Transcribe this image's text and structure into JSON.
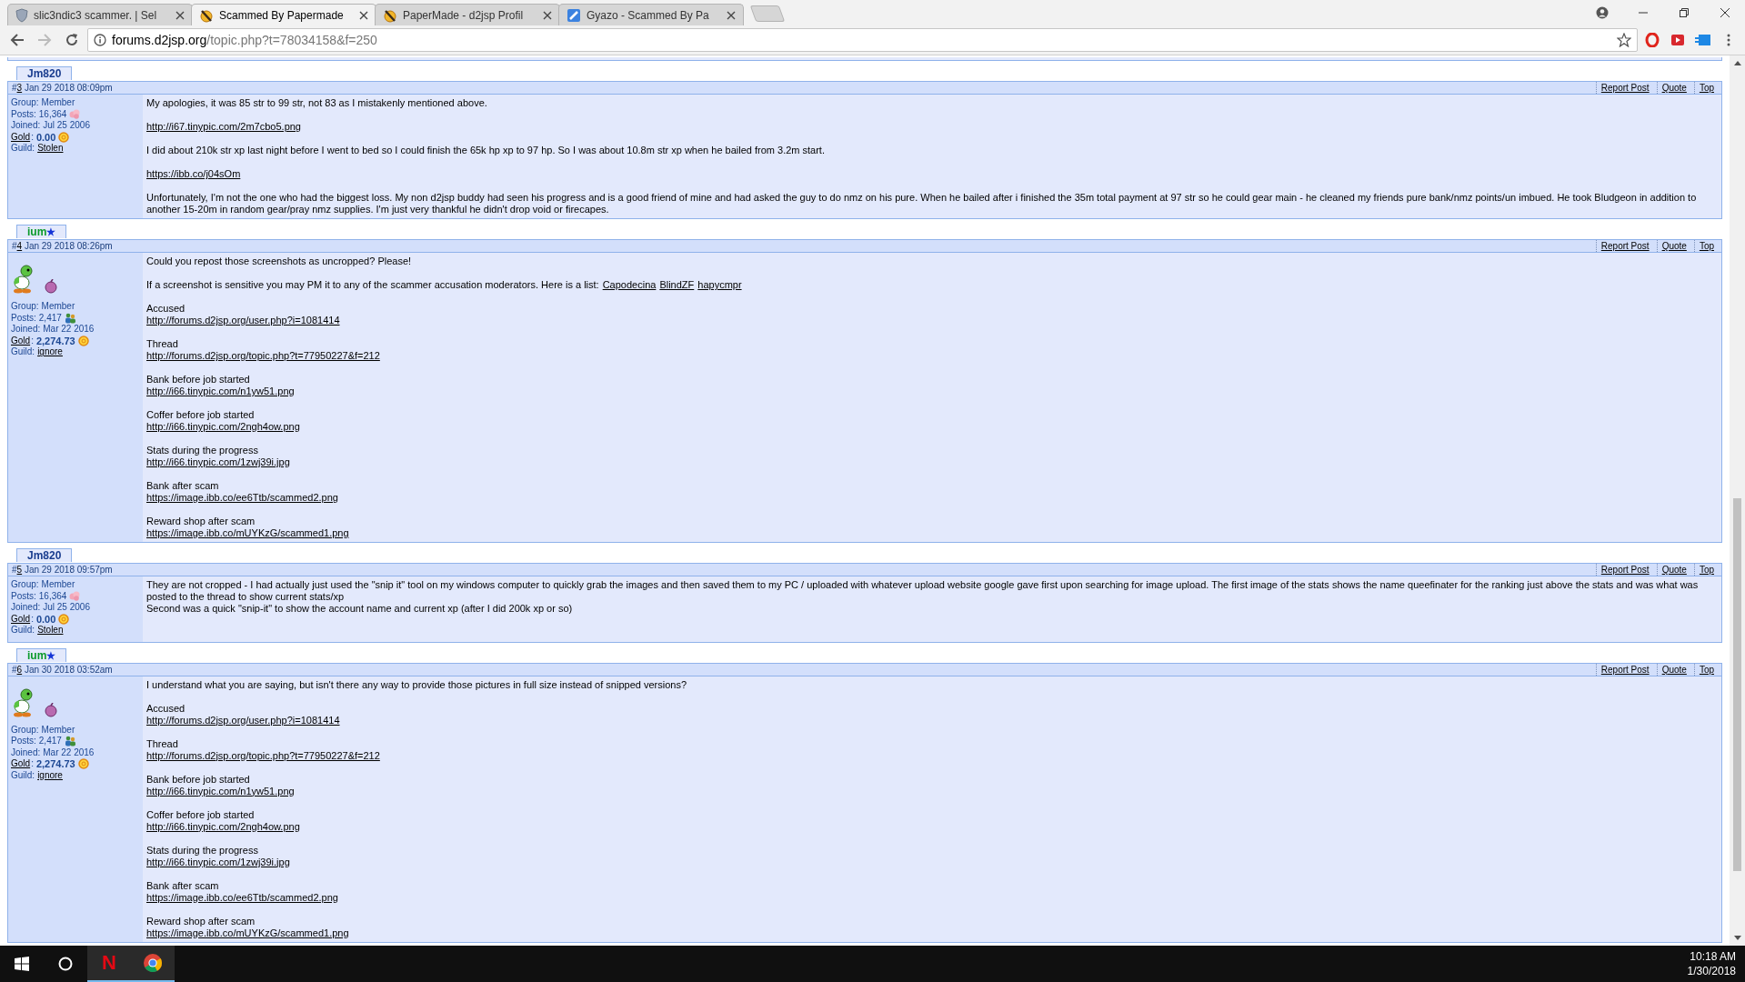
{
  "browser": {
    "tabs": [
      {
        "title": "slic3ndic3 scammer. | Sel",
        "kind": "shield",
        "selected": false
      },
      {
        "title": "Scammed By Papermade",
        "kind": "badge",
        "selected": true
      },
      {
        "title": "PaperMade - d2jsp Profil",
        "kind": "badge",
        "selected": false
      },
      {
        "title": "Gyazo - Scammed By Pa",
        "kind": "square",
        "selected": false
      }
    ],
    "address": {
      "host": "forums.d2jsp.org",
      "path": "/topic.php?t=78034158&f=250"
    }
  },
  "posts": [
    {
      "author": "Jm820",
      "color": "#1a3d8f",
      "hash": "#",
      "number": "3",
      "date": "Jan 29 2018 08:09pm",
      "actions": [
        "Report Post",
        "Quote",
        "Top"
      ],
      "avatar": false,
      "profile": [
        {
          "label": "Group:",
          "value": "Member"
        },
        {
          "label": "Posts:",
          "value": "16,364",
          "kind": "blob"
        },
        {
          "label": "Joined:",
          "value": "Jul 25 2006"
        },
        {
          "label": "Gold",
          "sep": ":",
          "value": "0.00",
          "kind": "gold"
        },
        {
          "label": "Guild:",
          "value": "Stolen",
          "kind": "guild"
        }
      ],
      "message": [
        [
          [
            {
              "kind": "text",
              "text": "My apologies, it was 85 str to 99 str, not 83 as I mistakenly mentioned above."
            }
          ]
        ],
        [
          [
            {
              "kind": "link",
              "text": "http://i67.tinypic.com/2m7cbo5.png"
            }
          ]
        ],
        [
          [
            {
              "kind": "text",
              "text": "I did about 210k str xp last night before I went to bed so I could finish the 65k hp xp to 97 hp. So I was about 10.8m str xp when he bailed from 3.2m start."
            }
          ]
        ],
        [
          [
            {
              "kind": "link",
              "text": "https://ibb.co/j04sOm"
            }
          ]
        ],
        [
          [
            {
              "kind": "text",
              "text": "Unfortunately, I'm not the one who had the biggest loss. My non d2jsp buddy had seen his progress and is a good friend of mine and had asked the guy to do nmz on his pure. When he bailed after i finished the 35m total payment at 97 str so he could gear main - he cleaned my friends pure bank/nmz points/un imbued. He took Bludgeon in addition to another 15-20m in random gear/pray nmz supplies. I'm just very thankful he didn't drop void or firecapes."
            }
          ]
        ]
      ]
    },
    {
      "author": "ium",
      "star": "★",
      "color": "#0b9a2a",
      "hash": "#",
      "number": "4",
      "date": "Jan 29 2018 08:26pm",
      "actions": [
        "Report Post",
        "Quote",
        "Top"
      ],
      "avatar": true,
      "profile": [
        {
          "label": "Group:",
          "value": "Member"
        },
        {
          "label": "Posts:",
          "value": "2,417",
          "kind": "people"
        },
        {
          "label": "Joined:",
          "value": "Mar 22 2016"
        },
        {
          "label": "Gold",
          "sep": ":",
          "value": "2,274.73",
          "kind": "gold"
        },
        {
          "label": "Guild:",
          "value": "ignore",
          "kind": "guild"
        }
      ],
      "message": [
        [
          [
            {
              "kind": "text",
              "text": "Could you repost those screenshots as uncropped? Please!"
            }
          ]
        ],
        [
          [
            {
              "kind": "text",
              "text": "If a screenshot is sensitive you may PM it to any of the scammer accusation moderators. Here is a list:"
            },
            {
              "kind": "link",
              "text": "Capodecina"
            },
            {
              "kind": "link",
              "text": "BlindZF"
            },
            {
              "kind": "link",
              "text": "hapycmpr"
            }
          ]
        ],
        [
          [
            {
              "kind": "text",
              "text": "Accused"
            }
          ],
          [
            {
              "kind": "link",
              "text": "http://forums.d2jsp.org/user.php?i=1081414"
            }
          ]
        ],
        [
          [
            {
              "kind": "text",
              "text": "Thread"
            }
          ],
          [
            {
              "kind": "link",
              "text": "http://forums.d2jsp.org/topic.php?t=77950227&f=212"
            }
          ]
        ],
        [
          [
            {
              "kind": "text",
              "text": "Bank before job started"
            }
          ],
          [
            {
              "kind": "link",
              "text": "http://i66.tinypic.com/n1yw51.png"
            }
          ]
        ],
        [
          [
            {
              "kind": "text",
              "text": "Coffer before job started"
            }
          ],
          [
            {
              "kind": "link",
              "text": "http://i66.tinypic.com/2ngh4ow.png"
            }
          ]
        ],
        [
          [
            {
              "kind": "text",
              "text": "Stats during the progress"
            }
          ],
          [
            {
              "kind": "link",
              "text": "http://i66.tinypic.com/1zwj39i.jpg"
            }
          ]
        ],
        [
          [
            {
              "kind": "text",
              "text": "Bank after scam"
            }
          ],
          [
            {
              "kind": "link",
              "text": "https://image.ibb.co/ee6Ttb/scammed2.png"
            }
          ]
        ],
        [
          [
            {
              "kind": "text",
              "text": "Reward shop after scam"
            }
          ],
          [
            {
              "kind": "link",
              "text": "https://image.ibb.co/mUYKzG/scammed1.png"
            }
          ]
        ]
      ]
    },
    {
      "author": "Jm820",
      "color": "#1a3d8f",
      "hash": "#",
      "number": "5",
      "date": "Jan 29 2018 09:57pm",
      "actions": [
        "Report Post",
        "Quote",
        "Top"
      ],
      "avatar": false,
      "profile": [
        {
          "label": "Group:",
          "value": "Member"
        },
        {
          "label": "Posts:",
          "value": "16,364",
          "kind": "blob"
        },
        {
          "label": "Joined:",
          "value": "Jul 25 2006"
        },
        {
          "label": "Gold",
          "sep": ":",
          "value": "0.00",
          "kind": "gold"
        },
        {
          "label": "Guild:",
          "value": "Stolen",
          "kind": "guild"
        }
      ],
      "message": [
        [
          [
            {
              "kind": "text",
              "text": "They are not cropped - I had actually just used the \"snip it\" tool on my windows computer to quickly grab the images and then saved them to my PC / uploaded with whatever upload website google gave first upon searching for image upload. The first image of the stats shows the name queefinater for the ranking just above the stats and was what was posted to the thread to show current stats/xp"
            }
          ],
          [
            {
              "kind": "text",
              "text": "Second was a quick \"snip-it\" to show the account name and current xp (after I did 200k xp or so)"
            }
          ]
        ]
      ]
    },
    {
      "author": "ium",
      "star": "★",
      "color": "#0b9a2a",
      "hash": "#",
      "number": "6",
      "date": "Jan 30 2018 03:52am",
      "actions": [
        "Report Post",
        "Quote",
        "Top"
      ],
      "avatar": true,
      "profile": [
        {
          "label": "Group:",
          "value": "Member"
        },
        {
          "label": "Posts:",
          "value": "2,417",
          "kind": "people"
        },
        {
          "label": "Joined:",
          "value": "Mar 22 2016"
        },
        {
          "label": "Gold",
          "sep": ":",
          "value": "2,274.73",
          "kind": "gold"
        },
        {
          "label": "Guild:",
          "value": "ignore",
          "kind": "guild"
        }
      ],
      "message": [
        [
          [
            {
              "kind": "text",
              "text": "I understand what you are saying, but isn't there any way to provide those pictures in full size instead of snipped versions?"
            }
          ]
        ],
        [
          [
            {
              "kind": "text",
              "text": "Accused"
            }
          ],
          [
            {
              "kind": "link",
              "text": "http://forums.d2jsp.org/user.php?i=1081414"
            }
          ]
        ],
        [
          [
            {
              "kind": "text",
              "text": "Thread"
            }
          ],
          [
            {
              "kind": "link",
              "text": "http://forums.d2jsp.org/topic.php?t=77950227&f=212"
            }
          ]
        ],
        [
          [
            {
              "kind": "text",
              "text": "Bank before job started"
            }
          ],
          [
            {
              "kind": "link",
              "text": "http://i66.tinypic.com/n1yw51.png"
            }
          ]
        ],
        [
          [
            {
              "kind": "text",
              "text": "Coffer before job started"
            }
          ],
          [
            {
              "kind": "link",
              "text": "http://i66.tinypic.com/2ngh4ow.png"
            }
          ]
        ],
        [
          [
            {
              "kind": "text",
              "text": "Stats during the progress"
            }
          ],
          [
            {
              "kind": "link",
              "text": "http://i66.tinypic.com/1zwj39i.jpg"
            }
          ]
        ],
        [
          [
            {
              "kind": "text",
              "text": "Bank after scam"
            }
          ],
          [
            {
              "kind": "link",
              "text": "https://image.ibb.co/ee6Ttb/scammed2.png"
            }
          ]
        ],
        [
          [
            {
              "kind": "text",
              "text": "Reward shop after scam"
            }
          ],
          [
            {
              "kind": "link",
              "text": "https://image.ibb.co/mUYKzG/scammed1.png"
            }
          ]
        ]
      ]
    }
  ],
  "taskbar": {
    "apps": [
      {
        "kind": "netflix",
        "glyph": "N",
        "running": true
      },
      {
        "kind": "chrome",
        "running": true
      }
    ],
    "time": "10:18 AM",
    "date": "1/30/2018"
  }
}
